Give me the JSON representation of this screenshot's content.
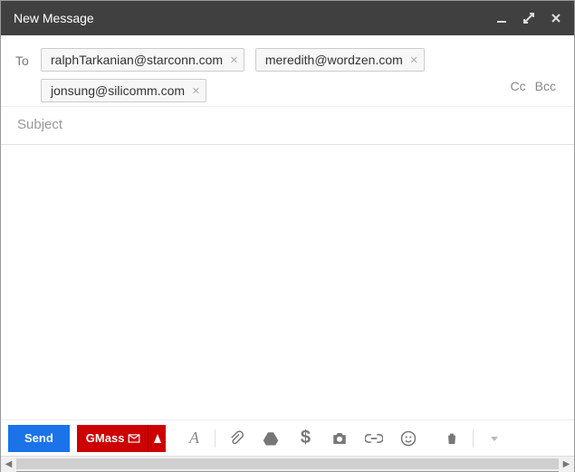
{
  "window": {
    "title": "New Message"
  },
  "to": {
    "label": "To",
    "recipients": [
      "ralphTarkanian@starconn.com",
      "meredith@wordzen.com",
      "jonsung@silicomm.com"
    ],
    "cc_label": "Cc",
    "bcc_label": "Bcc"
  },
  "subject": {
    "placeholder": "Subject",
    "value": ""
  },
  "body": {
    "text": ""
  },
  "toolbar": {
    "send_label": "Send",
    "gmass_label": "GMass"
  }
}
